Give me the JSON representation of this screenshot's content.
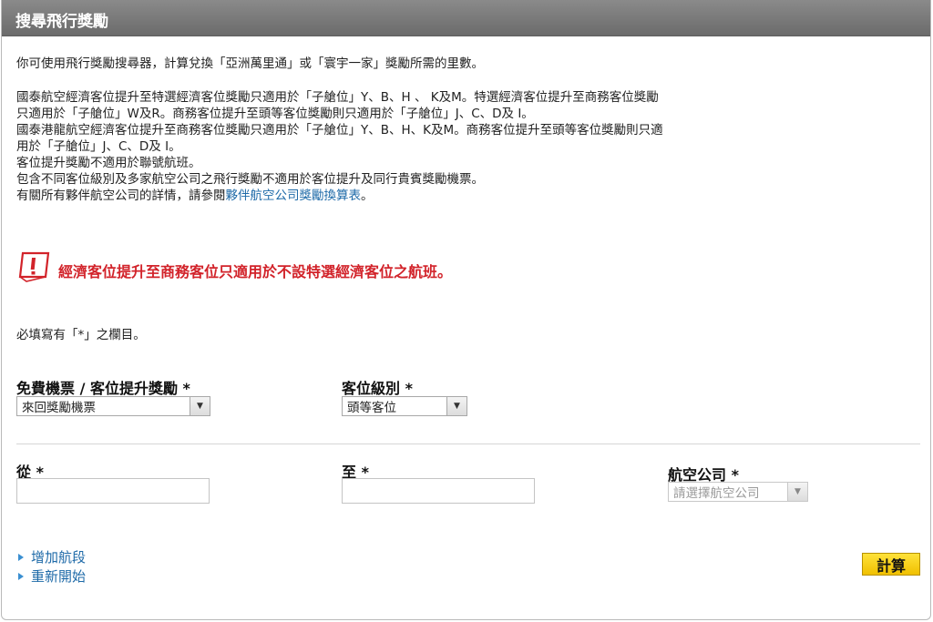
{
  "header": {
    "title": "搜尋飛行獎勵"
  },
  "intro": "你可使用飛行獎勵搜尋器，計算兌換「亞洲萬里通」或「寰宇一家」獎勵所需的里數。",
  "rules": {
    "line1": "國泰航空經濟客位提升至特選經濟客位獎勵只適用於「子艙位」Y、B、H 、 K及M。特選經濟客位提升至商務客位獎勵",
    "line2": "只適用於「子艙位」W及R。商務客位提升至頭等客位獎勵則只適用於「子艙位」J、C、D及 I。",
    "line3": "國泰港龍航空經濟客位提升至商務客位獎勵只適用於「子艙位」Y、B、H、K及M。商務客位提升至頭等客位獎勵則只適",
    "line4": "用於「子艙位」J、C、D及 I。",
    "line5": "客位提升獎勵不適用於聯號航班。",
    "line6": "包含不同客位級別及多家航空公司之飛行獎勵不適用於客位提升及同行貴賓獎勵機票。",
    "line7_prefix": "有關所有夥伴航空公司的詳情，請參閱",
    "line7_link": "夥伴航空公司獎勵換算表",
    "line7_suffix": "。"
  },
  "warning": {
    "icon": "warning-exclamation-icon",
    "text": "經濟客位提升至商務客位只適用於不設特選經濟客位之航班。",
    "color": "#d2232a"
  },
  "required_note": "必填寫有「*」之欄目。",
  "form": {
    "award_type_label": "免費機票 / 客位提升獎勵 *",
    "award_type_value": "來回獎勵機票",
    "cabin_label": "客位級別 *",
    "cabin_value": "頭等客位",
    "from_label": "從 *",
    "to_label": "至 *",
    "airline_label": "航空公司 *",
    "airline_placeholder": "請選擇航空公司"
  },
  "actions": {
    "add_segment": "增加航段",
    "restart": "重新開始",
    "calculate": "計算"
  },
  "colors": {
    "link": "#1e6aa8",
    "button": "#f5d000",
    "header": "#7a7a7a"
  }
}
